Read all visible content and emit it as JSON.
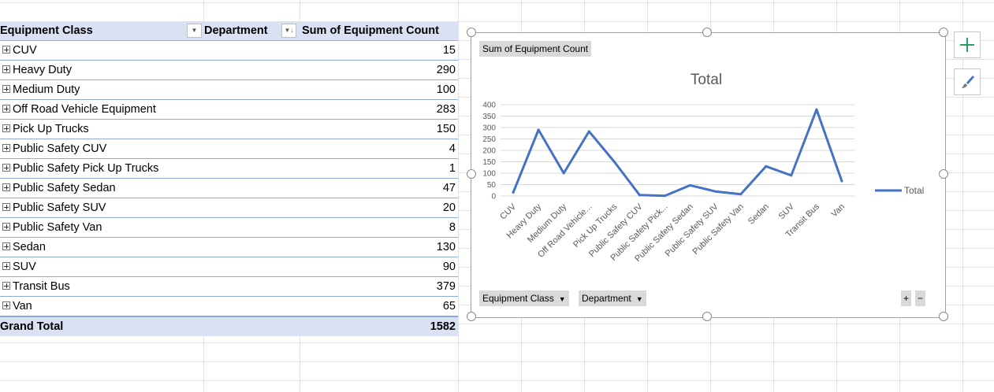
{
  "pivot": {
    "headers": {
      "row_field": "Equipment Class",
      "col_field": "Department",
      "value_field": "Sum of Equipment Count"
    },
    "rows": [
      {
        "label": "CUV",
        "value": "15"
      },
      {
        "label": "Heavy Duty",
        "value": "290"
      },
      {
        "label": "Medium Duty",
        "value": "100"
      },
      {
        "label": "Off Road Vehicle Equipment",
        "value": "283"
      },
      {
        "label": "Pick Up Trucks",
        "value": "150"
      },
      {
        "label": "Public Safety CUV",
        "value": "4"
      },
      {
        "label": "Public Safety Pick Up Trucks",
        "value": "1"
      },
      {
        "label": "Public Safety Sedan",
        "value": "47"
      },
      {
        "label": "Public Safety SUV",
        "value": "20"
      },
      {
        "label": "Public Safety Van",
        "value": "8"
      },
      {
        "label": "Sedan",
        "value": "130"
      },
      {
        "label": "SUV",
        "value": "90"
      },
      {
        "label": "Transit Bus",
        "value": "379"
      },
      {
        "label": "Van",
        "value": "65"
      }
    ],
    "grand_total_label": "Grand Total",
    "grand_total_value": "1582"
  },
  "chart": {
    "value_button": "Sum of Equipment Count",
    "axis_buttons": [
      "Equipment Class",
      "Department"
    ],
    "zoom_plus": "+",
    "zoom_minus": "−"
  },
  "chart_data": {
    "type": "line",
    "title": "Total",
    "categories": [
      "CUV",
      "Heavy Duty",
      "Medium Duty",
      "Off Road Vehicle...",
      "Pick Up Trucks",
      "Public Safety CUV",
      "Public Safety Pick...",
      "Public Safety Sedan",
      "Public Safety SUV",
      "Public Safety Van",
      "Sedan",
      "SUV",
      "Transit Bus",
      "Van"
    ],
    "series": [
      {
        "name": "Total",
        "values": [
          15,
          290,
          100,
          283,
          150,
          4,
          1,
          47,
          20,
          8,
          130,
          90,
          379,
          65
        ],
        "color": "#4472c4"
      }
    ],
    "y_ticks": [
      "0",
      "50",
      "100",
      "150",
      "200",
      "250",
      "300",
      "350",
      "400"
    ],
    "ylim": [
      0,
      400
    ],
    "grid": true,
    "legend": "right"
  },
  "side_buttons": {
    "add_icon": "plus-icon",
    "style_icon": "paintbrush-icon"
  }
}
